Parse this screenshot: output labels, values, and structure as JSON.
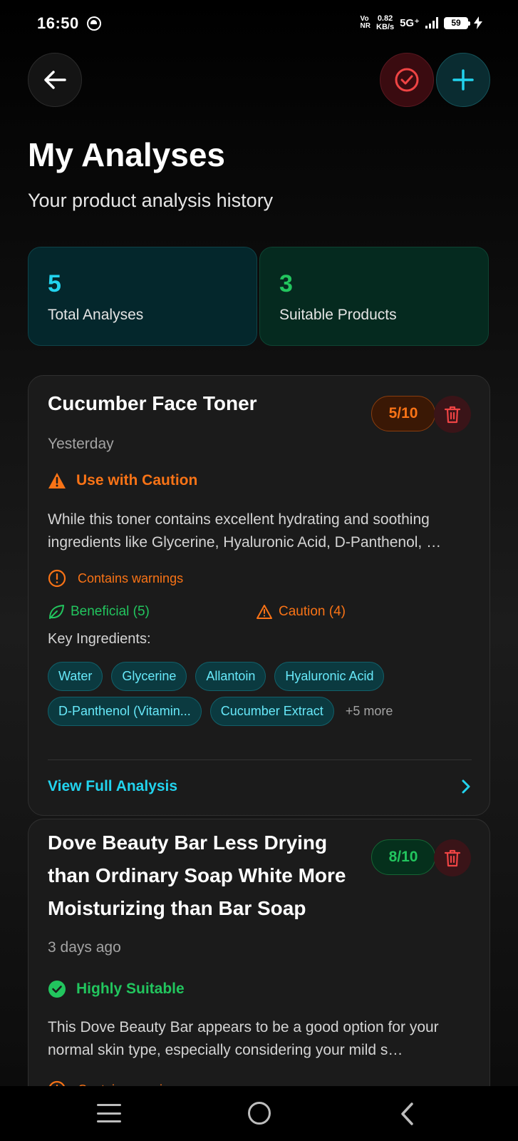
{
  "status_bar": {
    "time": "16:50",
    "vonr_top": "Vo",
    "vonr_bottom": "NR",
    "speed": "0.82",
    "speed_unit": "KB/s",
    "network": "5G⁺",
    "battery": "59"
  },
  "header": {
    "title": "My Analyses",
    "subtitle": "Your product analysis history"
  },
  "stats": {
    "total_value": "5",
    "total_label": "Total Analyses",
    "suitable_value": "3",
    "suitable_label": "Suitable Products"
  },
  "analyses": [
    {
      "title": "Cucumber Face Toner",
      "score": "5/10",
      "date": "Yesterday",
      "verdict": "Use with Caution",
      "summary": "While this toner contains excellent hydrating and soothing ingredients like Glycerine, Hyaluronic Acid, D-Panthenol, …",
      "warnings": "Contains warnings",
      "beneficial": "Beneficial (5)",
      "caution": "Caution (4)",
      "key_ingredients_label": "Key Ingredients:",
      "ingredients": [
        "Water",
        "Glycerine",
        "Allantoin",
        "Hyaluronic Acid",
        "D-Panthenol (Vitamin...",
        "Cucumber Extract"
      ],
      "more": "+5 more",
      "view_label": "View Full Analysis"
    },
    {
      "title": "Dove Beauty Bar Less Drying than Ordinary Soap White More Moisturizing than Bar Soap",
      "score": "8/10",
      "date": "3 days ago",
      "verdict": "Highly Suitable",
      "summary": "This Dove Beauty Bar appears to be a good option for your normal skin type, especially considering your mild s…",
      "warnings": "Contains warnings"
    }
  ],
  "colors": {
    "accent_cyan": "#22d3ee",
    "good_green": "#22c55e",
    "caution_orange": "#f97316",
    "danger_red": "#ef4444"
  }
}
